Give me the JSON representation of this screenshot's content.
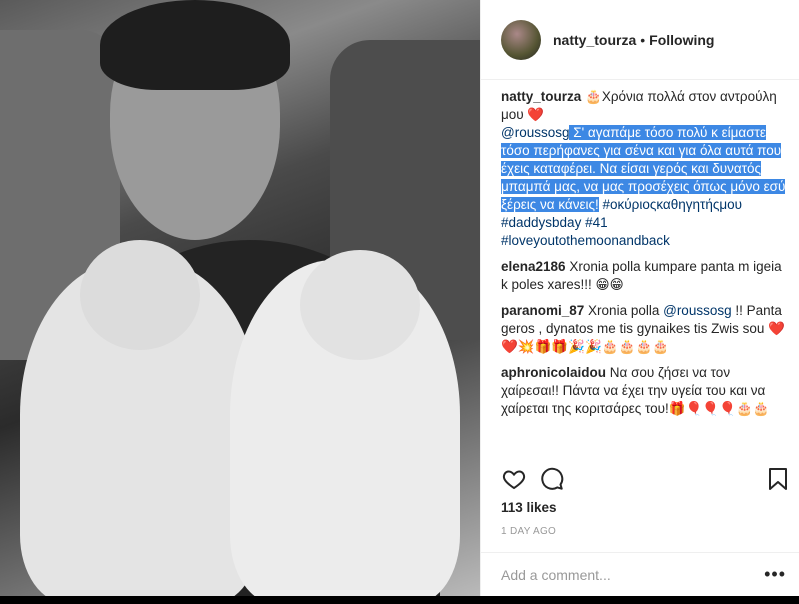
{
  "post": {
    "username": "natty_tourza",
    "separator": "•",
    "follow_status": "Following"
  },
  "caption": {
    "username": "natty_tourza",
    "text_1": " 🎂Χρόνια πολλά στον αντρούλη μου ❤️",
    "mention": "@roussosg",
    "highlighted": " Σ' αγαπάμε τόσο πολύ κ είμαστε τόσο περήφανες για σένα και για όλα αυτά που έχεις καταφέρει. Να είσαι γερός και δυνατός μπαμπά μας, να μας προσέχεις όπως μόνο εσύ ξέρεις να κάνεις!",
    "hashtags_1": " #οκύριοςκαθηγητήςμου",
    "hashtags_2": "#daddysbday #41",
    "hashtags_3": "#loveyoutothemoonandback"
  },
  "comments": [
    {
      "username": "elena2186",
      "text": " Xronia polla kumpare panta m igeia k poles xares!!! 😁😁"
    },
    {
      "username": "paranomi_87",
      "text_before": " Xronia polla ",
      "mention": "@roussosg",
      "text_after": " !! Panta geros , dynatos me tis gynaikes tis Zwis sou ❤️❤️💥🎁🎁🎉🎉🎂🎂🎂🎂"
    },
    {
      "username": "aphronicolaidou",
      "text": " Να σου ζήσει να τον χαίρεσαι!! Πάντα να έχει την υγεία του και να χαίρεται της κοριτσάρες του!🎁🎈🎈🎈🎂🎂"
    }
  ],
  "engagement": {
    "likes": "113 likes",
    "time": "1 DAY AGO"
  },
  "add_comment": {
    "placeholder": "Add a comment...",
    "more_label": "•••"
  },
  "icons": {
    "like": "heart-icon",
    "comment": "comment-icon",
    "save": "bookmark-icon"
  }
}
